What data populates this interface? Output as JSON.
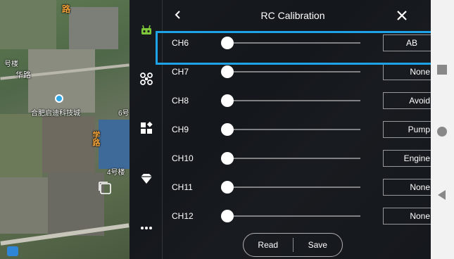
{
  "map": {
    "labels": [
      "路",
      "号楼",
      "华路",
      "合肥启迪科技城",
      "6号",
      "4号楼",
      "学路",
      "路",
      "科技城"
    ]
  },
  "header": {
    "title": "RC Calibration"
  },
  "channels": [
    {
      "label": "CH6",
      "function": "AB",
      "value": 0.0
    },
    {
      "label": "CH7",
      "function": "None",
      "value": 0.0
    },
    {
      "label": "CH8",
      "function": "Avoid",
      "value": 0.0
    },
    {
      "label": "CH9",
      "function": "Pump",
      "value": 0.0
    },
    {
      "label": "CH10",
      "function": "Engine",
      "value": 0.0
    },
    {
      "label": "CH11",
      "function": "None",
      "value": 0.0
    },
    {
      "label": "CH12",
      "function": "None",
      "value": 0.0
    }
  ],
  "buttons": {
    "read": "Read",
    "save": "Save"
  },
  "colors": {
    "highlight": "#1ea3e6",
    "panel": "#121418",
    "drone_icon": "#7ec63a"
  },
  "icons": [
    "remote-controller-icon",
    "drone-icon",
    "apps-icon",
    "diamond-icon",
    "more-icon",
    "layers-icon",
    "back-icon",
    "close-icon"
  ]
}
